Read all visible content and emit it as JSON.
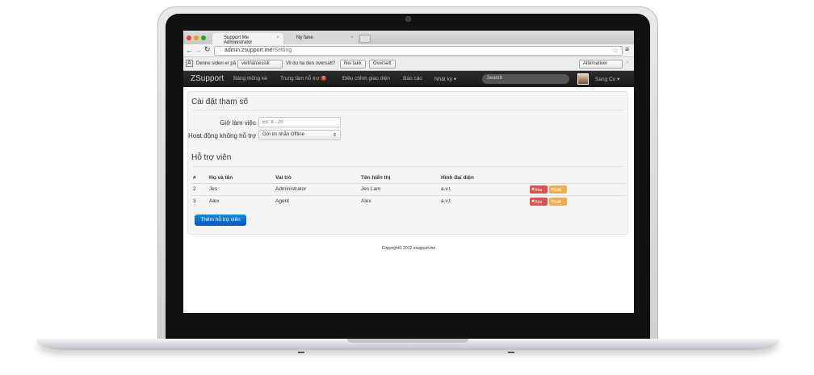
{
  "browser": {
    "tabs": [
      {
        "label": "Support Me Administrator"
      },
      {
        "label": "Ny fane"
      }
    ],
    "url_host": "admin.zsupport.me",
    "url_path": "/Setting"
  },
  "translate_bar": {
    "prefix": "Denne siden er på",
    "language": "vietnamesisk",
    "question": "Vil du ha den oversatt?",
    "no_button": "Nei takk",
    "translate_button": "Oversett",
    "options": "Alternativer"
  },
  "navbar": {
    "brand": "ZSupport",
    "items": [
      "Bảng thống kê",
      "Trung tâm hỗ trợ",
      "Điều chỉnh giao diện",
      "Báo cáo",
      "Nhật ký"
    ],
    "badge": "0",
    "search_placeholder": "Search",
    "user": "Sang Cu"
  },
  "settings": {
    "title": "Cài đặt tham số",
    "hours_label": "Giờ làm việc",
    "hours_placeholder": "Ex: 8 - 20",
    "offline_label": "Hoạt động không hỗ trợ",
    "offline_value": "Gửi tin nhắn Offline"
  },
  "agents": {
    "title": "Hỗ trợ viên",
    "columns": [
      "#",
      "Họ và tên",
      "Vai trò",
      "Tên hiển thị",
      "Hình đại diện"
    ],
    "rows": [
      {
        "id": "2",
        "name": "Jes",
        "role": "Administrator",
        "display": "Jes Lam",
        "avatar": "a.v.t"
      },
      {
        "id": "3",
        "name": "Alex",
        "role": "Agent",
        "display": "Alex",
        "avatar": "a.v.t"
      }
    ],
    "delete_label": "Xóa",
    "edit_label": "Edit",
    "add_button": "Thêm hỗ trợ viên"
  },
  "footer": {
    "copyright": "Copyright© 2012 zsupport.me"
  }
}
